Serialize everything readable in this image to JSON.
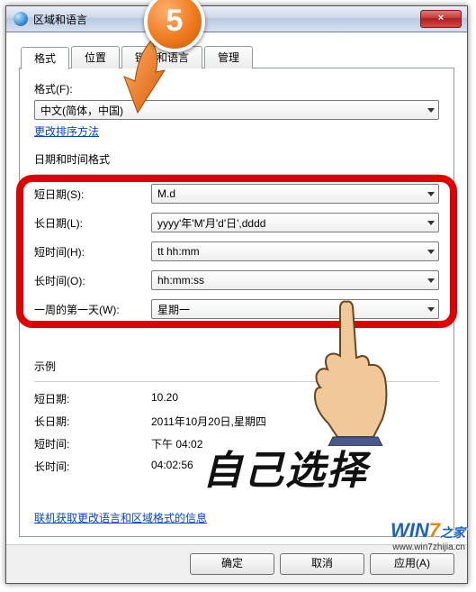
{
  "titlebar": {
    "title": "区域和语言",
    "close_symbol": "×"
  },
  "step_number": "5",
  "tabs": {
    "t0": "格式",
    "t1": "位置",
    "t2": "键盘和语言",
    "t3": "管理"
  },
  "format": {
    "label": "格式(F):",
    "value": "中文(简体，中国)",
    "sort_link": "更改排序方法"
  },
  "datetime": {
    "header": "日期和时间格式",
    "short_date_label": "短日期(S):",
    "short_date_value": "M.d",
    "long_date_label": "长日期(L):",
    "long_date_value": "yyyy'年'M'月'd'日',dddd",
    "short_time_label": "短时间(H):",
    "short_time_value": "tt hh:mm",
    "long_time_label": "长时间(O):",
    "long_time_value": "hh:mm:ss",
    "first_day_label": "一周的第一天(W):",
    "first_day_value": "星期一"
  },
  "example": {
    "header": "示例",
    "short_date_label": "短日期:",
    "short_date_value": "10.20",
    "long_date_label": "长日期:",
    "long_date_value": "2011年10月20日,星期四",
    "short_time_label": "短时间:",
    "short_time_value": "下午 04:02",
    "long_time_label": "长时间:",
    "long_time_value": "04:02:56"
  },
  "online_link": "联机获取更改语言和区域格式的信息",
  "buttons": {
    "ok": "确定",
    "cancel": "取消",
    "apply": "应用(A)"
  },
  "annotation_text": "自己选择",
  "watermark": {
    "brand_pre": "WIN",
    "brand_seven": "7",
    "brand_post": "之家",
    "url": "www.win7zhijia.cn"
  },
  "chart_data": null
}
